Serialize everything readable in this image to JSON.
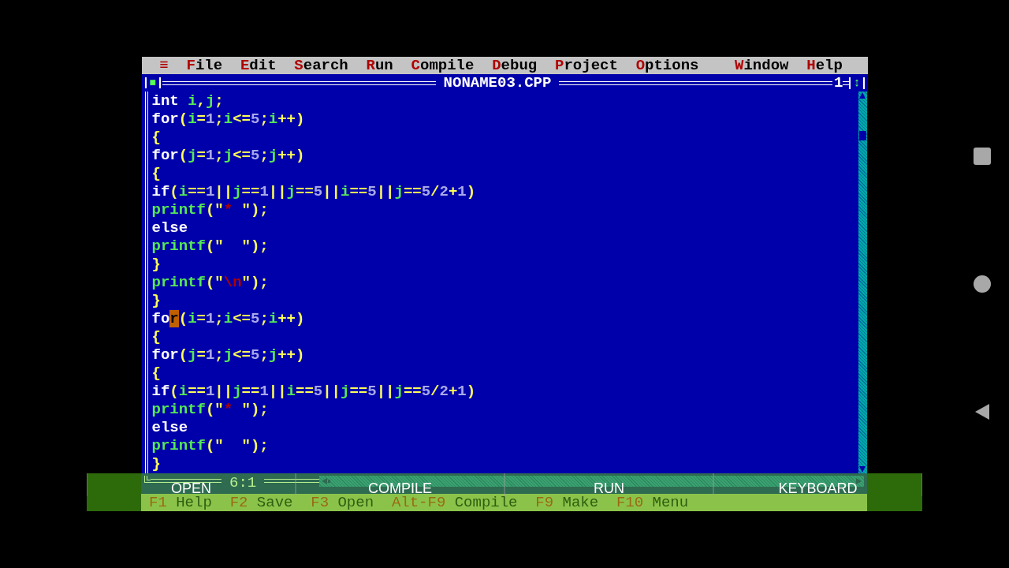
{
  "menu_bar": {
    "system_menu": "≡",
    "items": [
      {
        "hotkey": "F",
        "rest": "ile"
      },
      {
        "hotkey": "E",
        "rest": "dit"
      },
      {
        "hotkey": "S",
        "rest": "earch"
      },
      {
        "hotkey": "R",
        "rest": "un"
      },
      {
        "hotkey": "C",
        "rest": "ompile"
      },
      {
        "hotkey": "D",
        "rest": "ebug"
      },
      {
        "hotkey": "P",
        "rest": "roject"
      },
      {
        "hotkey": "O",
        "rest": "ptions"
      },
      {
        "hotkey": "W",
        "rest": "indow",
        "kind": "spaced"
      },
      {
        "hotkey": "H",
        "rest": "elp"
      }
    ]
  },
  "editor": {
    "close_button": "■",
    "title": "NONAME03.CPP",
    "window_number": "1",
    "zoom_button": "↕",
    "position": "6:1",
    "lines": [
      {
        "keyword": "int",
        "rest": " i,j;"
      },
      {
        "keyword": "for",
        "rest": "(i=1;i<=5;i++)"
      },
      {
        "rest": "{"
      },
      {
        "keyword": "for",
        "rest": "(j=1;j<=5;j++)"
      },
      {
        "rest": "{"
      },
      {
        "keyword": "if",
        "rest": "(i==1||j==1||j==5||i==5||j==5/2+1)"
      },
      {
        "rest": "printf(\"* \");"
      },
      {
        "keyword": "else"
      },
      {
        "rest": "printf(\"  \");"
      },
      {
        "rest": "}"
      },
      {
        "rest": "printf(\"\\n\");"
      },
      {
        "rest": "}"
      },
      {
        "keyword": "fo",
        "cursor": "r",
        "rest": "(i=1;i<=5;i++)"
      },
      {
        "rest": "{"
      },
      {
        "keyword": "for",
        "rest": "(j=1;j<=5;j++)"
      },
      {
        "rest": "{"
      },
      {
        "keyword": "if",
        "rest": "(i==1||j==1||i==5||j==5||j==5/2+1)"
      },
      {
        "rest": "printf(\"* \");"
      },
      {
        "keyword": "else"
      },
      {
        "rest": "printf(\"  \");"
      },
      {
        "rest": "}"
      }
    ]
  },
  "status_line": [
    {
      "key": "F1",
      "label": "Help"
    },
    {
      "key": "F2",
      "label": "Save"
    },
    {
      "key": "F3",
      "label": "Open"
    },
    {
      "key": "Alt-F9",
      "label": "Compile"
    },
    {
      "key": "F9",
      "label": "Make"
    },
    {
      "key": "F10",
      "label": "Menu"
    }
  ],
  "overlay_buttons": [
    "OPEN",
    "COMPILE",
    "RUN",
    "KEYBOARD"
  ]
}
